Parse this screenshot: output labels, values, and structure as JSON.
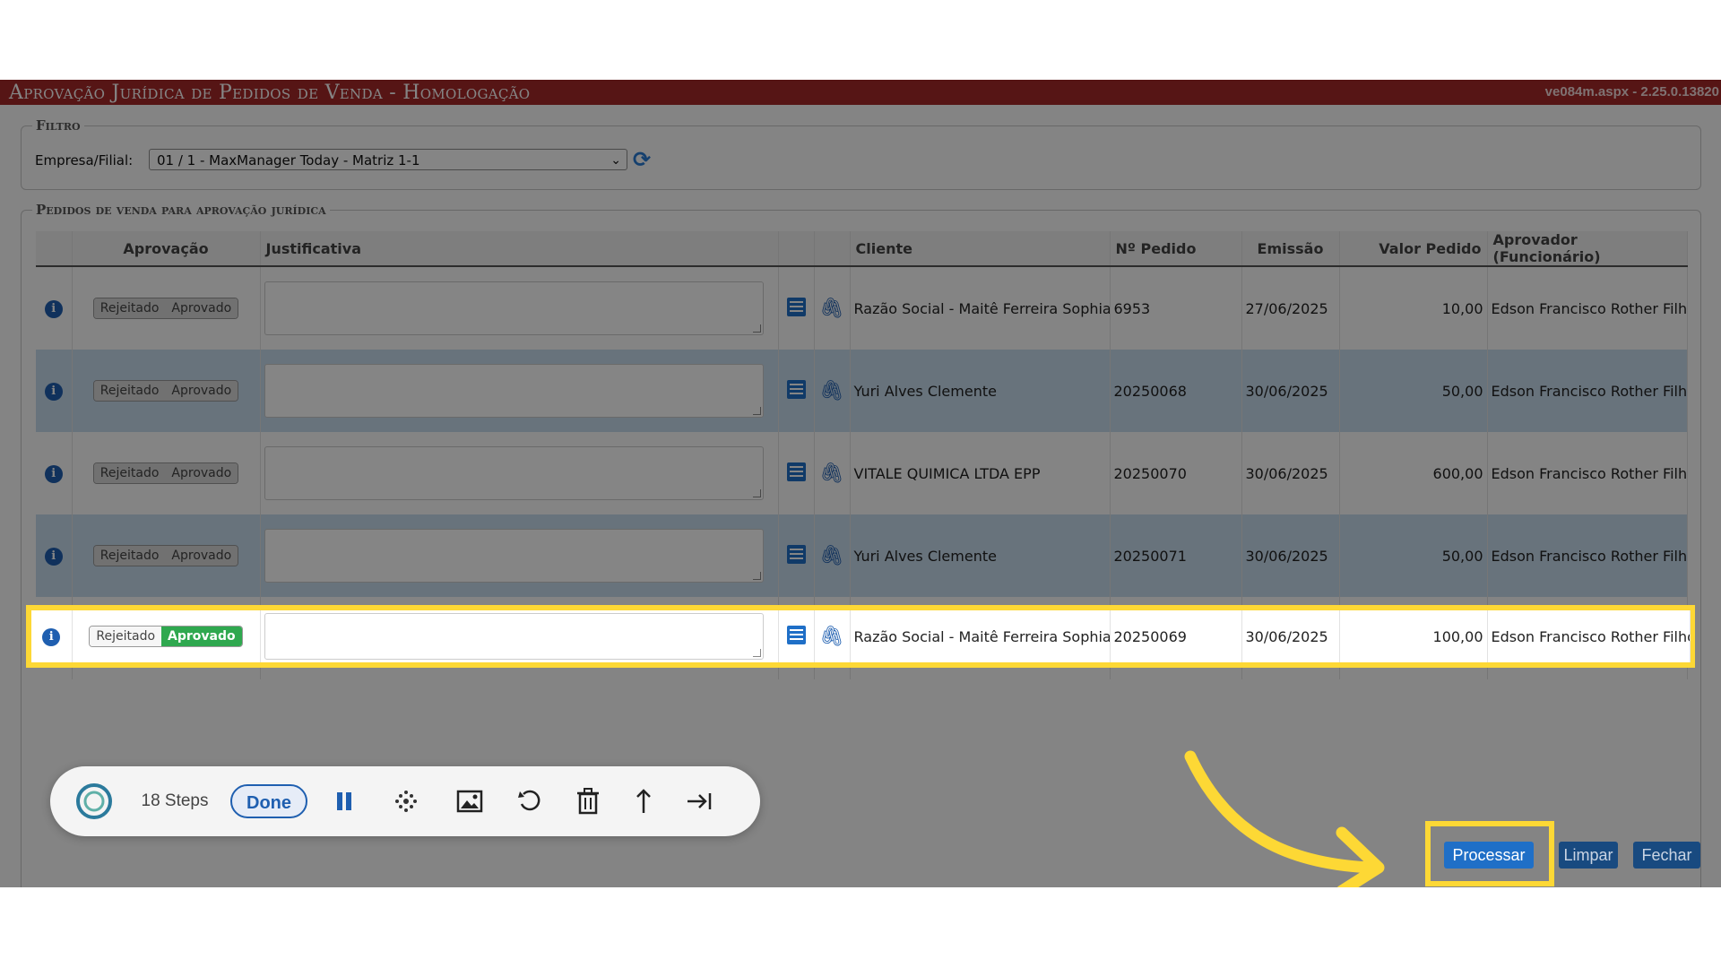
{
  "window": {
    "title": "Aprovação Jurídica de Pedidos de Venda - Homologação",
    "version": "ve084m.aspx - 2.25.0.13820"
  },
  "filtro": {
    "legend": "Filtro",
    "label": "Empresa/Filial:",
    "selected": "01 / 1 - MaxManager Today - Matriz 1-1"
  },
  "pedidos": {
    "legend": "Pedidos de venda para aprovação jurídica",
    "headers": [
      "",
      "Aprovação",
      "Justificativa",
      "",
      "",
      "Cliente",
      "Nº Pedido",
      "Emissão",
      "Valor Pedido",
      "Aprovador (Funcionário)"
    ],
    "toggle": {
      "rejected": "Rejeitado",
      "approved": "Aprovado"
    },
    "rows": [
      {
        "state": "none",
        "cliente": "Razão Social - Maitê Ferreira Sophia",
        "pedido": "6953",
        "emissao": "27/06/2025",
        "valor": "10,00",
        "aprovador": "Edson Francisco Rother Filho"
      },
      {
        "state": "none",
        "cliente": "Yuri Alves Clemente",
        "pedido": "20250068",
        "emissao": "30/06/2025",
        "valor": "50,00",
        "aprovador": "Edson Francisco Rother Filho"
      },
      {
        "state": "none",
        "cliente": "VITALE QUIMICA LTDA EPP",
        "pedido": "20250070",
        "emissao": "30/06/2025",
        "valor": "600,00",
        "aprovador": "Edson Francisco Rother Filho"
      },
      {
        "state": "none",
        "cliente": "Yuri Alves Clemente",
        "pedido": "20250071",
        "emissao": "30/06/2025",
        "valor": "50,00",
        "aprovador": "Edson Francisco Rother Filho"
      },
      {
        "state": "approved",
        "cliente": "Razão Social - Maitê Ferreira Sophia",
        "pedido": "20250069",
        "emissao": "30/06/2025",
        "valor": "100,00",
        "aprovador": "Edson Francisco Rother Filho"
      }
    ]
  },
  "buttons": {
    "processar": "Processar",
    "limpar": "Limpar",
    "fechar": "Fechar"
  },
  "recorder": {
    "steps": "18 Steps",
    "done": "Done"
  },
  "colors": {
    "titlebar": "#a52a2a",
    "highlight": "#fdd835",
    "primary": "#1f6fc7",
    "approved": "#2fa84f"
  },
  "icons": [
    "info-icon",
    "list-icon",
    "paperclip-icon",
    "refresh-icon",
    "pause-icon",
    "blur-icon",
    "image-icon",
    "undo-icon",
    "trash-icon",
    "share-icon",
    "skip-end-icon",
    "arrow-annotation-icon"
  ]
}
